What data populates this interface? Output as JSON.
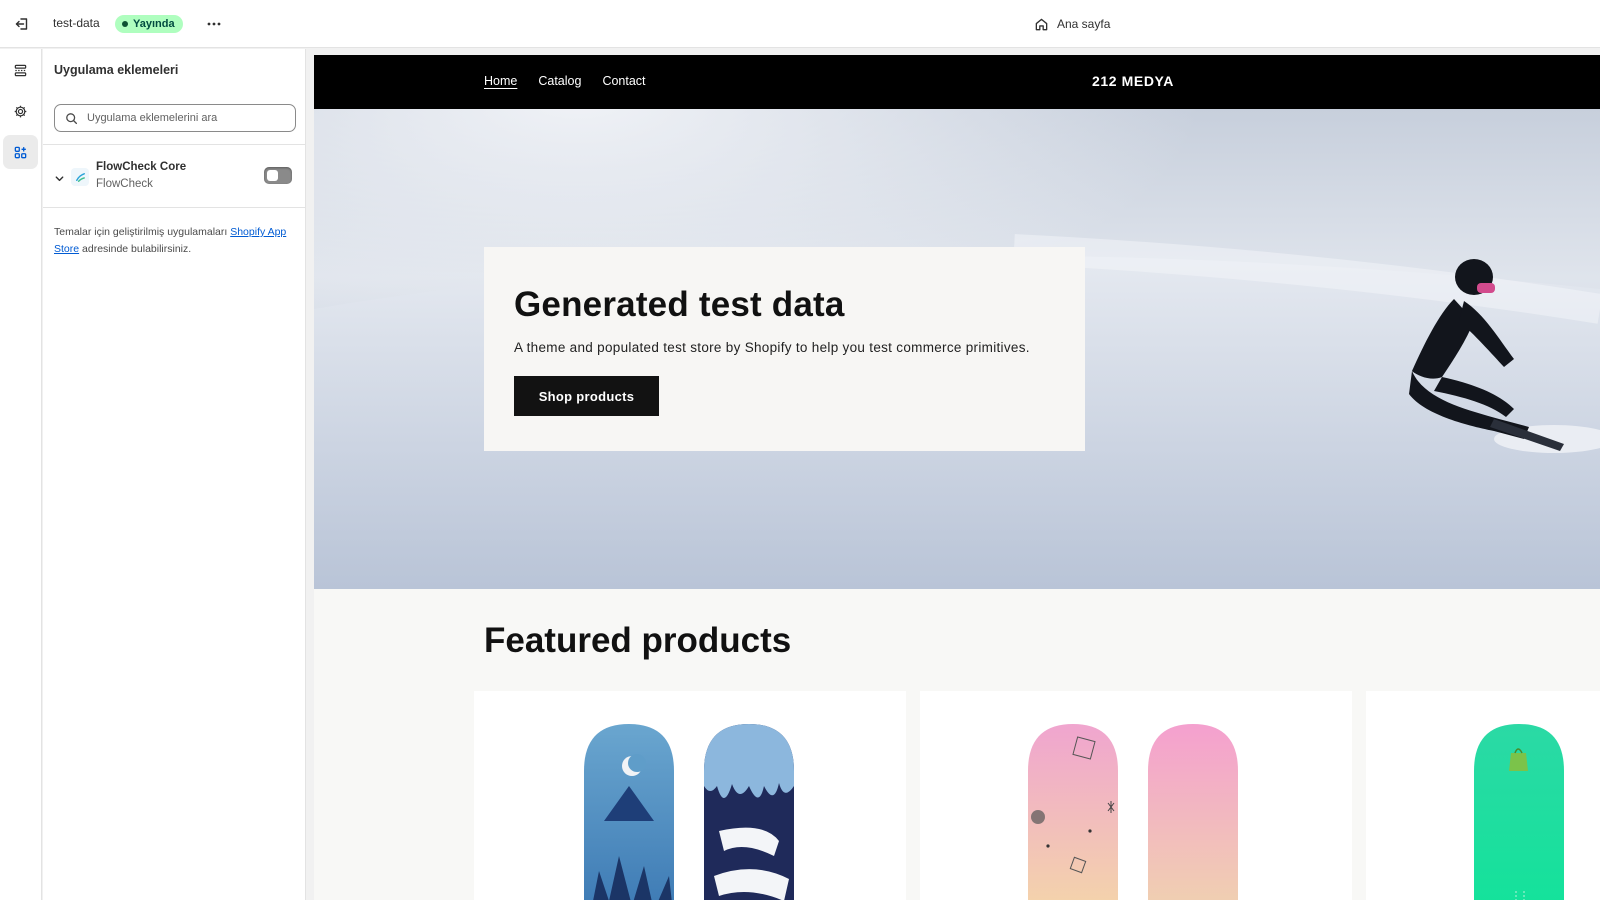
{
  "topbar": {
    "theme_name": "test-data",
    "status_badge": "Yayında",
    "page_selector": "Ana sayfa"
  },
  "sidebar": {
    "title": "Uygulama eklemeleri",
    "search_placeholder": "Uygulama eklemelerini ara",
    "extension": {
      "name": "FlowCheck Core",
      "vendor": "FlowCheck",
      "enabled": false
    },
    "help_text_before": "Temalar için geliştirilmiş uygulamaları ",
    "help_link": "Shopify App Store",
    "help_text_after": " adresinde bulabilirsiniz."
  },
  "store": {
    "nav": [
      "Home",
      "Catalog",
      "Contact"
    ],
    "active_nav": "Home",
    "logo": "212 MEDYA",
    "hero": {
      "title": "Generated test data",
      "subtitle": "A theme and populated test store by Shopify to help you test commerce primitives.",
      "button": "Shop products"
    },
    "featured_title": "Featured products"
  },
  "colors": {
    "badge_bg": "#affebf",
    "link": "#005bd3",
    "store_header": "#000000"
  }
}
